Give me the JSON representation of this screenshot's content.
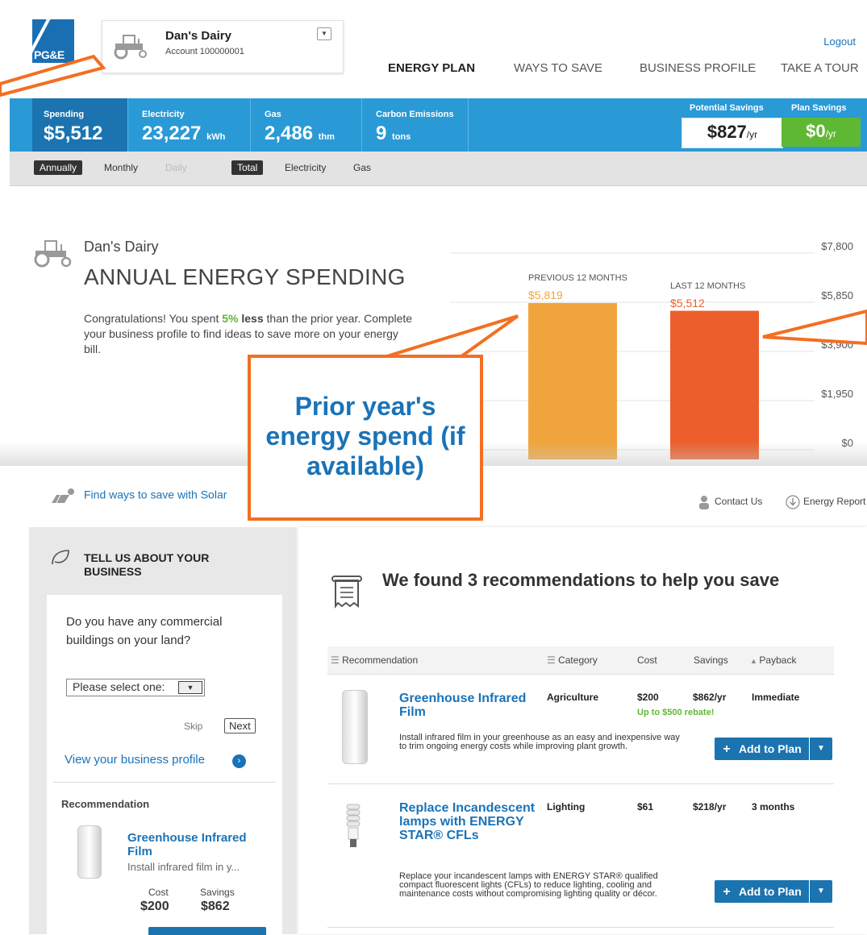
{
  "header": {
    "logo_text": "PG&E",
    "account": {
      "name": "Dan's Dairy",
      "number": "Account 100000001"
    },
    "logout": "Logout",
    "nav": [
      "ENERGY PLAN",
      "WAYS TO SAVE",
      "BUSINESS PROFILE",
      "TAKE A TOUR"
    ]
  },
  "stats": {
    "spending": {
      "label": "Spending",
      "value": "$5,512"
    },
    "electricity": {
      "label": "Electricity",
      "value": "23,227",
      "unit": "kWh"
    },
    "gas": {
      "label": "Gas",
      "value": "2,486",
      "unit": "thm"
    },
    "carbon": {
      "label": "Carbon Emissions",
      "value": "9",
      "unit": "tons"
    },
    "potential_savings": {
      "label": "Potential Savings",
      "value": "$827",
      "unit": "/yr"
    },
    "plan_savings": {
      "label": "Plan Savings",
      "value": "$0",
      "unit": "/yr"
    }
  },
  "filters": {
    "period": [
      "Annually",
      "Monthly",
      "Daily"
    ],
    "type": [
      "Total",
      "Electricity",
      "Gas"
    ]
  },
  "spending": {
    "business": "Dan's Dairy",
    "title": "ANNUAL ENERGY SPENDING",
    "msg_pre": "Congratulations! You spent ",
    "msg_pct": "5%",
    "msg_less": " less",
    "msg_post": " than the prior year. Complete your business profile to find ideas to save more on your energy bill."
  },
  "chart_data": {
    "type": "bar",
    "categories": [
      "PREVIOUS 12 MONTHS",
      "LAST 12 MONTHS"
    ],
    "values": [
      5819,
      5512
    ],
    "data_labels": [
      "$5,819",
      "$5,512"
    ],
    "colors": [
      "#f0a53c",
      "#ec5f2c"
    ],
    "y_ticks": [
      "$0",
      "$1,950",
      "$3,900",
      "$5,850",
      "$7,800"
    ],
    "ylim": [
      0,
      7800
    ]
  },
  "links": {
    "solar": "Find ways to save with Solar",
    "contact": "Contact Us",
    "report": "Energy Report"
  },
  "profile": {
    "heading": "TELL US ABOUT YOUR BUSINESS",
    "question": "Do you have any commercial buildings on your land?",
    "select": "Please select one:",
    "skip": "Skip",
    "next": "Next",
    "view": "View your business profile",
    "rec_label": "Recommendation",
    "rec_title": "Greenhouse Infrared Film",
    "rec_desc": "Install infrared film in y...",
    "cost_label": "Cost",
    "cost": "$200",
    "savings_label": "Savings",
    "savings": "$862"
  },
  "recommendations": {
    "title": "We found 3 recommendations to help you save",
    "columns": [
      "Recommendation",
      "Category",
      "Cost",
      "Savings",
      "Payback"
    ],
    "add_label": "Add to Plan",
    "items": [
      {
        "title": "Greenhouse Infrared Film",
        "category": "Agriculture",
        "cost": "$200",
        "rebate": "Up to $500 rebate!",
        "savings": "$862/yr",
        "payback": "Immediate",
        "desc": "Install infrared film in your greenhouse as an easy and inexpensive way to trim ongoing energy costs while improving plant growth."
      },
      {
        "title": "Replace Incandescent lamps with ENERGY STAR® CFLs",
        "category": "Lighting",
        "cost": "$61",
        "savings": "$218/yr",
        "payback": "3 months",
        "desc": "Replace your incandescent lamps with ENERGY STAR® qualified compact fluorescent lights (CFLs) to reduce lighting, cooling and maintenance costs without compromising lighting quality or décor."
      }
    ]
  },
  "callout": {
    "text": "Prior year's energy spend (if available)"
  },
  "colors": {
    "accent_blue": "#2a9ad6",
    "dark_blue": "#1b74b0",
    "orange": "#f36f21",
    "green": "#5fb833"
  }
}
